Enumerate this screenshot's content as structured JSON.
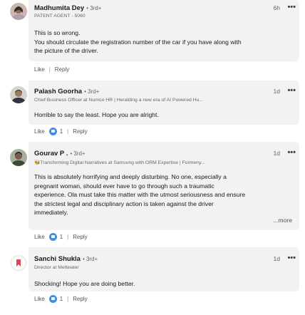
{
  "comments": [
    {
      "name": "Madhumita Dey",
      "degree": "• 3rd+",
      "headline": "PATENT AGENT - 5060",
      "time": "6h",
      "lines": [
        "This is so wrong.",
        "You should circulate the registration number of the car if you have along with",
        "the picture of the driver."
      ],
      "like_label": "Like",
      "reply_label": "Reply",
      "reaction_count": ""
    },
    {
      "name": "Palash Goorha",
      "degree": "• 3rd+",
      "headline": "Chief Business Officer at Numoo HR | Heralding a new era of AI Powered Hu...",
      "time": "1d",
      "lines": [
        "Horrible to say the least. Hope you are alright."
      ],
      "like_label": "Like",
      "reply_label": "Reply",
      "reaction_count": "1"
    },
    {
      "name": "Gourav P .",
      "degree": "• 3rd+",
      "headline": "🐝Transforming Digital Narratives at Samsung with ORM Expertise | Formeny...",
      "time": "1d",
      "lines": [
        "This is absolutely horrifying and deeply disturbing. No one, especially a",
        "pregnant woman, should ever have to go through such a traumatic",
        "experience. Ola must take this matter with the utmost seriousness and ensure",
        "the strictest legal and disciplinary action is taken against the driver",
        "immediately."
      ],
      "more_label": "...more",
      "like_label": "Like",
      "reply_label": "Reply",
      "reaction_count": "1"
    },
    {
      "name": "Sanchi Shukla",
      "degree": "• 3rd+",
      "headline": "Director at Meltwater",
      "time": "1d",
      "lines": [
        "Shocking! Hope you are doing better."
      ],
      "like_label": "Like",
      "reply_label": "Reply",
      "reaction_count": "1"
    }
  ],
  "dots_glyph": "•••",
  "colors": {
    "card": "#f2f2f2",
    "like_blue": "#378fe9",
    "muted": "#666666"
  }
}
